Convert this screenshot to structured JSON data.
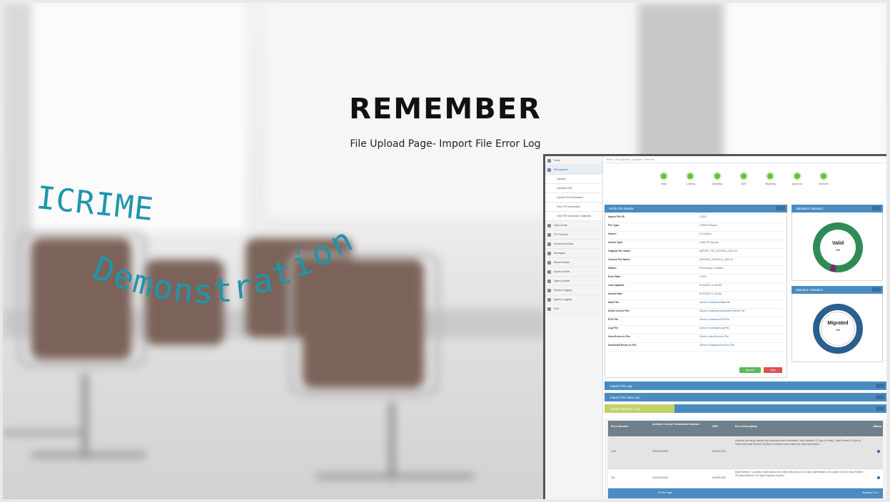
{
  "slide": {
    "title": "REMEMBER",
    "subtitle": "File Upload Page- Import File Error Log",
    "watermark_line1": "ICRIME",
    "watermark_line2": "Demonstration"
  },
  "app": {
    "breadcrumb": "Home > File Importer > Uploads > View File",
    "sidebar": [
      {
        "label": "Home",
        "active": false
      },
      {
        "label": "File Importer",
        "active": true
      },
      {
        "label": "Uploads",
        "sub": true
      },
      {
        "label": "Uploaded File",
        "sub": true
      },
      {
        "label": "Upload File Submission",
        "sub": true
      },
      {
        "label": "View FIR Submission",
        "sub": true
      },
      {
        "label": "View FIR Submission Statistics",
        "sub": true
      },
      {
        "label": "Data Centre"
      },
      {
        "label": "FIR Forensic"
      },
      {
        "label": "Anonymous Data"
      },
      {
        "label": "Messages"
      },
      {
        "label": "Report Builder"
      },
      {
        "label": "System Admin"
      },
      {
        "label": "Agency Admin"
      },
      {
        "label": "System Logging"
      },
      {
        "label": "Agency Logging"
      },
      {
        "label": "FAQ"
      }
    ],
    "steps": [
      "Initial",
      "Loading",
      "Validating",
      "QDR",
      "Migrating",
      "Approval",
      "Archived"
    ],
    "verify_panel": {
      "title": "Verify File Details",
      "rows": [
        {
          "k": "Import File ID:",
          "v": "11503"
        },
        {
          "k": "File Type:",
          "v": "CHRIS Extracts"
        },
        {
          "k": "Owner:",
          "v": "ICS Admin"
        },
        {
          "k": "Action Type:",
          "v": "Initial FIR Upload"
        },
        {
          "k": "Original File Name:",
          "v": "IMPORT_FIR_20200511_0001.txt"
        },
        {
          "k": "Current File Name:",
          "v": "00000016_20200511_0001.txt"
        },
        {
          "k": "Status:",
          "v": "Processing Complete"
        },
        {
          "k": "Error Rate:",
          "v": "1.00%"
        },
        {
          "k": "Last Updated:",
          "v": "5/19/2020 11:08 AM"
        },
        {
          "k": "Arrival Date:",
          "v": "5/19/2020 11:08 AM"
        },
        {
          "k": "Data File:",
          "v": "Click to Download Data File",
          "link": true
        },
        {
          "k": "Delete Kernel File:",
          "v": "Click to Download and Delete Kernel File",
          "link": true
        },
        {
          "k": "ETA File:",
          "v": "Click to Download ETA File",
          "link": true
        },
        {
          "k": "Log File:",
          "v": "Click to Download Log File",
          "link": true
        },
        {
          "k": "View Errors in File:",
          "v": "Click to View Errors in File",
          "link": true
        },
        {
          "k": "Download Errors in File:",
          "v": "Click to Download Errors in File",
          "link": true
        }
      ],
      "approve_label": "Approve",
      "stop_label": "Stop"
    },
    "validation_panel": {
      "title": "Validation Statistics",
      "center_label": "Valid",
      "center_value": "298",
      "valid_fraction": 0.96
    },
    "migration_panel": {
      "title": "Migration Statistics",
      "center_label": "Migrated",
      "center_value": "298"
    },
    "bars": [
      "Import File Log",
      "Import File Data Line",
      "Import File Error Log"
    ],
    "error_table": {
      "headers": [
        "Error Number",
        "Incident / Arrest Transaction Number",
        "DFR",
        "Error Description",
        "Status"
      ],
      "rows": [
        {
          "num": "1201",
          "txn": "202200000000",
          "dfr": "HAHRF1200",
          "desc": "Incidents are being reported with unknown event information. Data Element 12 (Type of Victim), Data Element 23 (Sex of Victim) and Data Element 18 (Race of Victim) must contain the victim information ..."
        },
        {
          "num": "109",
          "txn": "202200000000",
          "dfr": "HAHRF1200",
          "desc": "Data Element 7 (Location Code) cannot be a valid entry and is not a valid representation of Location Code 6. Data Element 25 (Data Element 7) of Type Property Loss/Etc..."
        }
      ],
      "pager_left": "25 Per Page",
      "pager_right": "Showing 1 to 2"
    },
    "colors": {
      "panel_blue": "#4a8bc2",
      "step_green": "#6bbf3c",
      "valid_green": "#2e8b57",
      "migrated_blue": "#2a6aa8",
      "watermark": "#1e95ad"
    }
  }
}
